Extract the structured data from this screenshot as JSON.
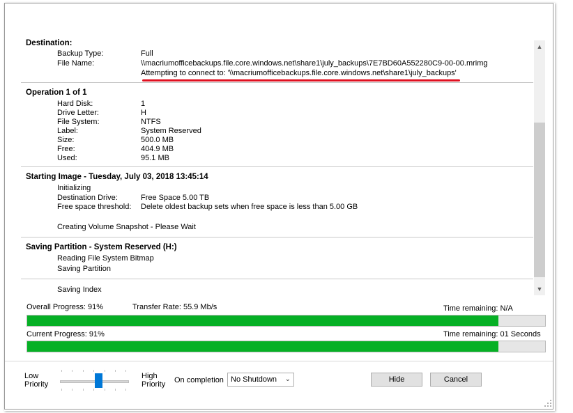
{
  "destination": {
    "heading": "Destination:",
    "rows": [
      {
        "label": "Backup Type:",
        "value": "Full"
      },
      {
        "label": "File Name:",
        "value": "\\\\macriumofficebackups.file.core.windows.net\\share1\\july_backups\\7E7BD60A552280C9-00-00.mrimg"
      }
    ],
    "connect_message": "Attempting to connect to: '\\\\macriumofficebackups.file.core.windows.net\\share1\\july_backups'"
  },
  "operation": {
    "heading": "Operation 1 of 1",
    "rows": [
      {
        "label": "Hard Disk:",
        "value": "1"
      },
      {
        "label": "Drive Letter:",
        "value": "H"
      },
      {
        "label": "File System:",
        "value": "NTFS"
      },
      {
        "label": "Label:",
        "value": "System Reserved"
      },
      {
        "label": "Size:",
        "value": "500.0 MB"
      },
      {
        "label": "Free:",
        "value": "404.9 MB"
      },
      {
        "label": "Used:",
        "value": "95.1 MB"
      }
    ]
  },
  "starting_image": {
    "heading": "Starting Image - Tuesday, July 03, 2018 13:45:14",
    "initializing": "Initializing",
    "rows": [
      {
        "label": "Destination Drive:",
        "value": "Free Space 5.00 TB"
      },
      {
        "label": "Free space threshold:",
        "value": "Delete oldest backup sets when free space is less than 5.00 GB"
      }
    ],
    "snapshot": "Creating Volume Snapshot - Please Wait"
  },
  "saving_partition": {
    "heading": "Saving Partition - System Reserved (H:)",
    "lines": [
      "Reading File System Bitmap",
      "Saving Partition"
    ]
  },
  "saving_index": "Saving Index",
  "overall": {
    "label": "Overall Progress:  91%",
    "transfer": "Transfer Rate: 55.9 Mb/s",
    "remaining": "Time remaining: N/A",
    "progress": 0.91
  },
  "current": {
    "label": "Current Progress:  91%",
    "remaining": "Time remaining: 01 Seconds",
    "progress": 0.91
  },
  "priority": {
    "low": [
      "Low",
      "Priority"
    ],
    "high": [
      "High",
      "Priority"
    ],
    "level": 0.58
  },
  "completion": {
    "label": "On completion",
    "selected": "No Shutdown"
  },
  "buttons": {
    "hide": "Hide",
    "cancel": "Cancel"
  },
  "colors": {
    "progress_fill": "#06b025",
    "annotation_underline": "#e01020",
    "slider_thumb": "#0078d7"
  }
}
